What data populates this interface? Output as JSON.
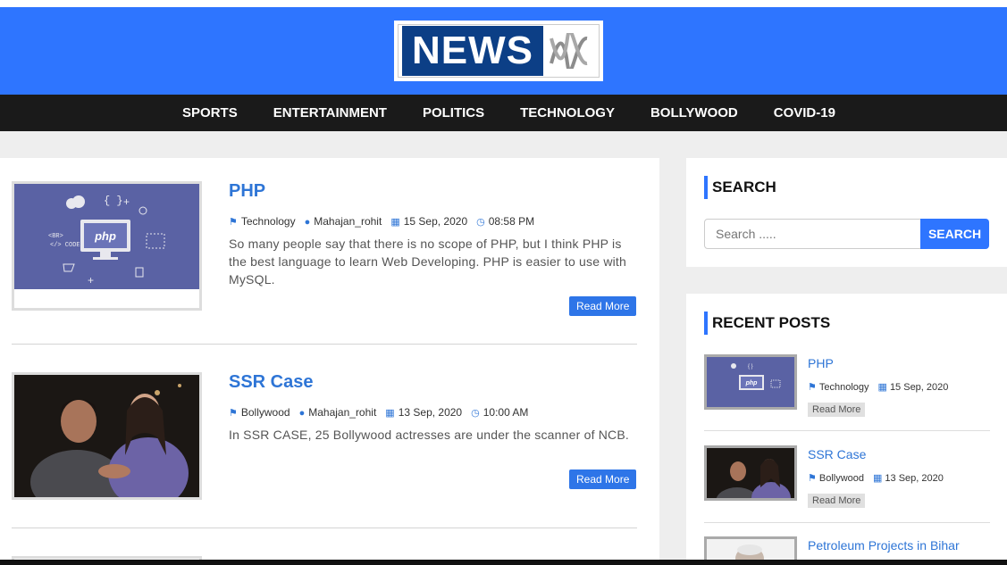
{
  "header": {
    "logo_text": "NEWS",
    "logo_mark": "ꟿ"
  },
  "nav": [
    "SPORTS",
    "ENTERTAINMENT",
    "POLITICS",
    "TECHNOLOGY",
    "BOLLYWOOD",
    "COVID-19"
  ],
  "posts": [
    {
      "title": "PHP",
      "category": "Technology",
      "author": "Mahajan_rohit",
      "date": "15 Sep, 2020",
      "time": "08:58 PM",
      "excerpt": "So many people say that there is no scope of PHP, but I think PHP is the best language to learn Web Developing. PHP is easier to use with MySQL.",
      "read_more": "Read More",
      "thumb_label": "php"
    },
    {
      "title": "SSR Case",
      "category": "Bollywood",
      "author": "Mahajan_rohit",
      "date": "13 Sep, 2020",
      "time": "10:00 AM",
      "excerpt": "In SSR CASE, 25 Bollywood actresses are under the scanner of NCB.",
      "read_more": "Read More"
    }
  ],
  "search": {
    "title": "SEARCH",
    "placeholder": "Search .....",
    "button": "SEARCH"
  },
  "recent": {
    "title": "RECENT POSTS",
    "items": [
      {
        "title": "PHP",
        "category": "Technology",
        "date": "15 Sep, 2020",
        "read_more": "Read More"
      },
      {
        "title": "SSR Case",
        "category": "Bollywood",
        "date": "13 Sep, 2020",
        "read_more": "Read More"
      },
      {
        "title": "Petroleum Projects in Bihar"
      }
    ]
  },
  "colors": {
    "accent": "#2e75ff",
    "nav_bg": "#1a1a1a",
    "link": "#2e75d6"
  },
  "icons": {
    "category": "tags-icon",
    "author": "user-icon",
    "date": "calendar-icon",
    "time": "clock-icon"
  }
}
